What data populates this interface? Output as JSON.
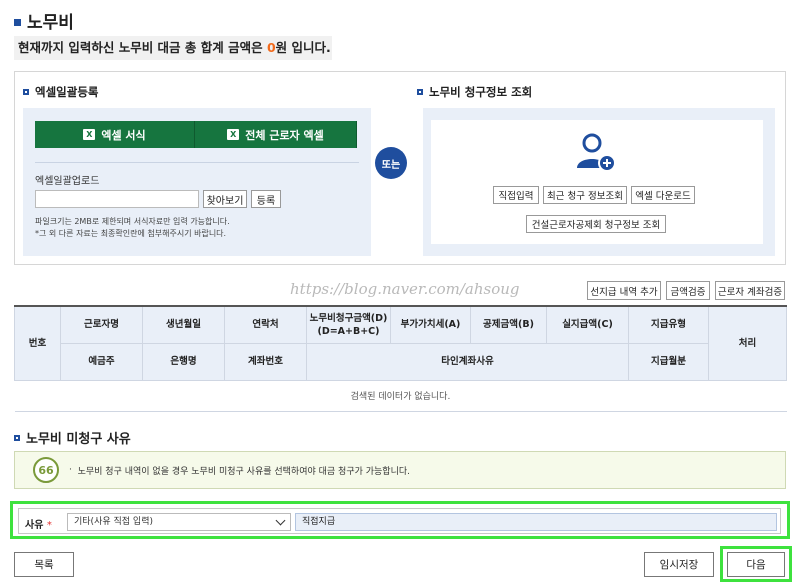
{
  "page": {
    "title": "노무비",
    "summary_prefix": "현재까지 입력하신 노무비 대금 총 합계 금액은 ",
    "summary_amount": "0",
    "summary_suffix": "원 입니다."
  },
  "excel_section": {
    "heading": "엑셀일괄등록",
    "excel_form_button": "엑셀 서식",
    "all_workers_excel_button": "전체 근로자 엑셀",
    "upload_label": "엑셀일괄업로드",
    "browse_button": "찾아보기",
    "register_button": "등록",
    "note1": "파일크기는 2MB로 제한되며 서식자료만 입력 가능합니다.",
    "note2": "*그 외 다른 자료는 최종확인란에 첨부해주시기 바랍니다."
  },
  "or_label": "또는",
  "claim_section": {
    "heading": "노무비 청구정보 조회",
    "direct_input_button": "직접입력",
    "recent_claim_button": "최근 청구 정보조회",
    "excel_download_button": "엑셀 다운로드",
    "cwma_claim_button": "건설근로자공제회 청구정보 조회"
  },
  "watermark": "https://blog.naver.com/ahsoug",
  "table_buttons": {
    "advance_payment_add": "선지급 내역 추가",
    "amount_check": "금액검증",
    "worker_account_check": "근로자 계좌검증"
  },
  "table": {
    "headers_row1": {
      "no": "번호",
      "worker_name": "근로자명",
      "birth_date": "생년월일",
      "contact": "연락처",
      "claim_amount": "노무비청구금액(D)",
      "claim_formula": "(D=A+B+C)",
      "vat": "부가가치세(A)",
      "deduction": "공제금액(B)",
      "actual_payment": "실지급액(C)",
      "payment_type": "지급유형",
      "action": "처리"
    },
    "headers_row2": {
      "account_holder": "예금주",
      "bank_name": "은행명",
      "account_number": "계좌번호",
      "third_party_reason": "타인계좌사유",
      "payment_month": "지급월분"
    },
    "empty_message": "검색된 데이터가 없습니다."
  },
  "unclaimed_section": {
    "heading": "노무비 미청구 사유",
    "notice": "노무비 청구 내역이 없을 경우 노무비 미청구 사유를 선택하여야 대금 청구가 가능합니다.",
    "reason_label": "사유",
    "required_mark": "*",
    "reason_selected": "기타(사유 직접 입력)",
    "reason_input_value": "직접지급"
  },
  "footer": {
    "list_button": "목록",
    "temp_save_button": "임시저장",
    "next_button": "다음"
  },
  "colors": {
    "accent": "#1f4e9e",
    "excel_green": "#16753f",
    "highlight_green": "#3ee23e",
    "amount_orange": "#f26b1d"
  }
}
